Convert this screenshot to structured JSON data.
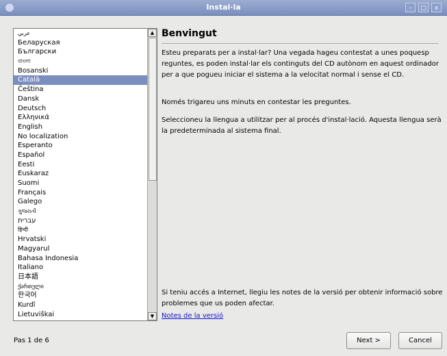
{
  "window": {
    "title": "Instal·la",
    "controls": {
      "minimize": "–",
      "maximize": "□",
      "close": "x"
    }
  },
  "languages": {
    "items": [
      {
        "label": "عربي",
        "small": true
      },
      {
        "label": "Беларуская"
      },
      {
        "label": "Български"
      },
      {
        "label": "বাংলা",
        "small": true
      },
      {
        "label": "Bosanski"
      },
      {
        "label": "Català",
        "selected": true
      },
      {
        "label": "Čeština"
      },
      {
        "label": "Dansk"
      },
      {
        "label": "Deutsch"
      },
      {
        "label": "Ελληνικά"
      },
      {
        "label": "English"
      },
      {
        "label": "No localization"
      },
      {
        "label": "Esperanto"
      },
      {
        "label": "Español"
      },
      {
        "label": "Eesti"
      },
      {
        "label": "Euskaraz"
      },
      {
        "label": "Suomi"
      },
      {
        "label": "Français"
      },
      {
        "label": "Galego"
      },
      {
        "label": "ગુજરાતી",
        "small": true
      },
      {
        "label": "עברית"
      },
      {
        "label": "हिन्दी",
        "small": true
      },
      {
        "label": "Hrvatski"
      },
      {
        "label": "Magyarul"
      },
      {
        "label": "Bahasa Indonesia"
      },
      {
        "label": "Italiano"
      },
      {
        "label": "日本語"
      },
      {
        "label": "ქართული",
        "small": true
      },
      {
        "label": "한국어"
      },
      {
        "label": "Kurdî"
      },
      {
        "label": "Lietuviškai"
      }
    ],
    "scroll_up": "▲",
    "scroll_down": "▼"
  },
  "main": {
    "heading": "Benvingut",
    "para1": "Esteu preparats per a instal·lar? Una vegada hageu contestat a unes poquesp reguntes, es poden instal·lar els continguts del CD autònom en aquest ordinador per a que pogueu iniciar el sistema a la velocitat normal i sense el CD.",
    "para2": "Només trigareu uns minuts en contestar les preguntes.",
    "para3": "Seleccioneu la llengua a utilitzar per al procés d'instal·lació. Aquesta llengua serà la predeterminada al sistema final.",
    "para4": "Si teniu accés a Internet, llegiu les notes de la versió per obtenir informació sobre problemes que us poden afectar.",
    "release_notes_link": "Notes de la versió"
  },
  "footer": {
    "step": "Pas 1 de 6",
    "next": "Next >",
    "cancel": "Cancel"
  }
}
